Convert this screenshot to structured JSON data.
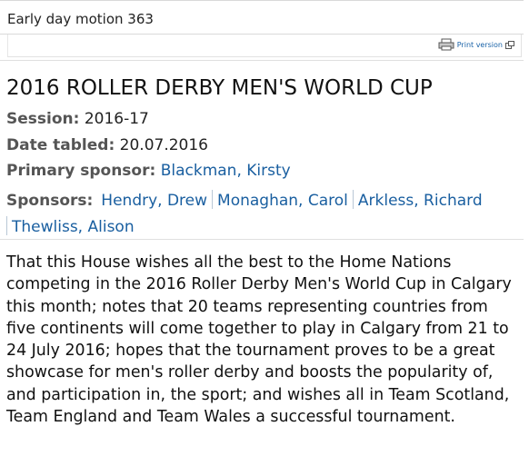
{
  "header": {
    "title": "Early day motion 363"
  },
  "print": {
    "label": "Print version",
    "icon": "printer-icon",
    "ext_icon": "new-window-icon"
  },
  "motion": {
    "title": "2016 ROLLER DERBY MEN'S WORLD CUP",
    "session_label": "Session:",
    "session_value": "2016-17",
    "date_label": "Date tabled:",
    "date_value": "20.07.2016",
    "primary_label": "Primary sponsor:",
    "primary_value": "Blackman, Kirsty",
    "sponsors_label": "Sponsors:",
    "sponsors": [
      "Hendry, Drew",
      "Monaghan, Carol",
      "Arkless, Richard",
      "Thewliss, Alison"
    ],
    "text": "That this House wishes all the best to the Home Nations competing in the 2016 Roller Derby Men's World Cup in Calgary this month; notes that 20 teams representing countries from five continents will come together to play in Calgary from 21 to 24 July 2016; hopes that the tournament proves to be a great showcase for men's roller derby and boosts the popularity of, and participation in, the sport; and wishes all in Team Scotland, Team England and Team Wales a successful tournament."
  },
  "colors": {
    "link": "#1a5fa0",
    "label": "#555555",
    "text": "#111111"
  }
}
